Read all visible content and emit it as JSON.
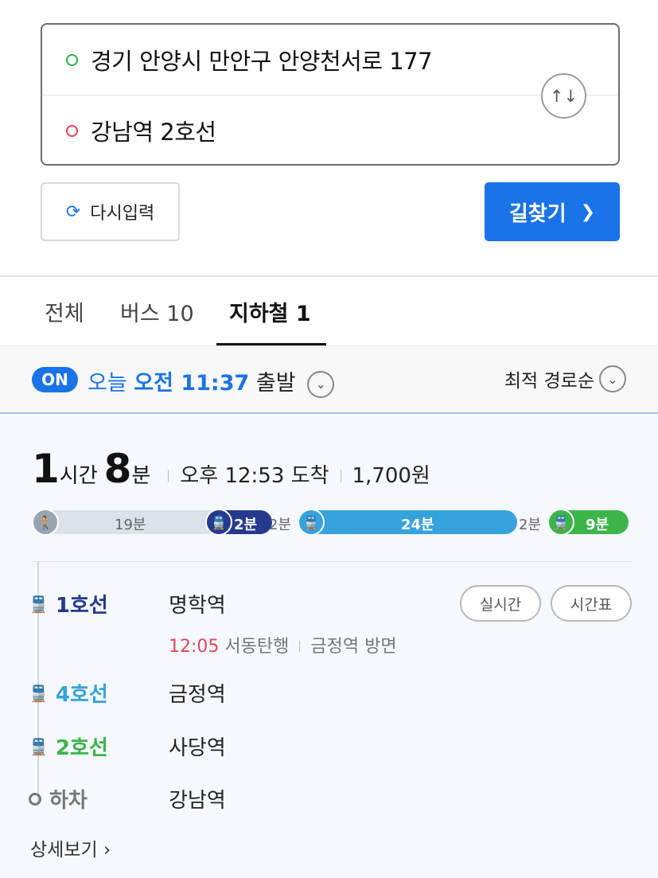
{
  "search": {
    "origin": "경기 안양시 만안구 안양천서로 177",
    "destination": "강남역 2호선",
    "swap_icon": "↑↓",
    "reset_label": "다시입력",
    "find_label": "길찾기"
  },
  "tabs": [
    {
      "label": "전체"
    },
    {
      "label": "버스 10"
    },
    {
      "label": "지하철 1"
    }
  ],
  "filter": {
    "on_label": "ON",
    "today_label": "오늘",
    "time": "오전 11:37",
    "depart_label": "출발",
    "sort_label": "최적 경로순"
  },
  "summary": {
    "hours": "1",
    "hours_unit": "시간",
    "minutes": "8",
    "minutes_unit": "분",
    "arrival": "오후 12:53 도착",
    "fare": "1,700원"
  },
  "segments": {
    "walk": "19분",
    "line1": "2분",
    "transfer1": "2분",
    "line4": "24분",
    "transfer2": "2분",
    "line2": "9분"
  },
  "steps": [
    {
      "line": "1호선",
      "station": "명학역",
      "color": "#253a8e"
    },
    {
      "line": "4호선",
      "station": "금정역",
      "color": "#36a2de"
    },
    {
      "line": "2호선",
      "station": "사당역",
      "color": "#3bb54a"
    },
    {
      "line": "하차",
      "station": "강남역",
      "color": "#777777"
    }
  ],
  "step1_detail": {
    "time": "12:05",
    "direction": "서동탄행",
    "platform": "금정역 방면"
  },
  "buttons": {
    "realtime": "실시간",
    "timetable": "시간표"
  },
  "more_label": "상세보기",
  "colors": {
    "accent": "#1a73e8",
    "line1": "#253a8e",
    "line4": "#36a2de",
    "line2": "#3bb54a",
    "red": "#e0465d"
  }
}
